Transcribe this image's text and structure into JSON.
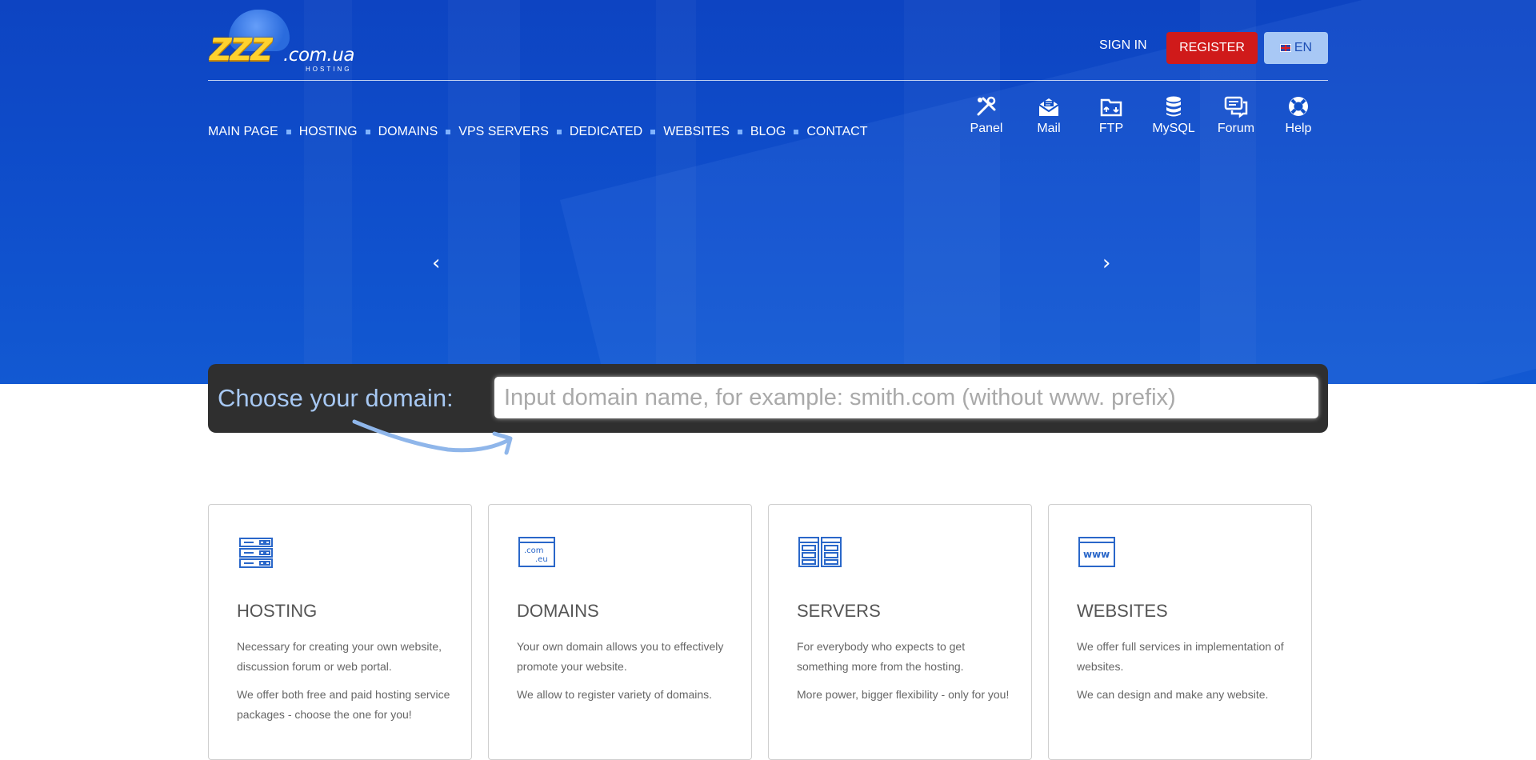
{
  "logo": {
    "zzz": "ZZZ",
    "domain": ".com.ua",
    "tagline": "HOSTING"
  },
  "header": {
    "signin": "SIGN IN",
    "register": "REGISTER",
    "lang": "EN"
  },
  "nav": [
    "MAIN PAGE",
    "HOSTING",
    "DOMAINS",
    "VPS SERVERS",
    "DEDICATED",
    "WEBSITES",
    "BLOG",
    "CONTACT"
  ],
  "tools": [
    {
      "label": "Panel",
      "icon": "tools-icon"
    },
    {
      "label": "Mail",
      "icon": "mail-icon"
    },
    {
      "label": "FTP",
      "icon": "ftp-icon"
    },
    {
      "label": "MySQL",
      "icon": "database-icon"
    },
    {
      "label": "Forum",
      "icon": "forum-icon"
    },
    {
      "label": "Help",
      "icon": "lifebuoy-icon"
    }
  ],
  "slider": {
    "prev": "‹",
    "next": "›"
  },
  "domain_search": {
    "label": "Choose your domain:",
    "placeholder": "Input domain name, for example: smith.com (without www. prefix)"
  },
  "cards": [
    {
      "title": "HOSTING",
      "p1": "Necessary for creating your own website, discussion forum or web portal.",
      "p2": "We offer both free and paid hosting service packages - choose the one for you!"
    },
    {
      "title": "DOMAINS",
      "p1": "Your own domain allows you to effectively promote your website.",
      "p2": "We allow to register variety of domains."
    },
    {
      "title": "SERVERS",
      "p1": "For everybody who expects to get something more from the hosting.",
      "p2": "More power, bigger flexibility - only for you!"
    },
    {
      "title": "WEBSITES",
      "p1": "We offer full services in implementation of websites.",
      "p2": "We can design and make any website."
    }
  ],
  "colors": {
    "hero": "#0f4fcc",
    "register": "#d01a1a",
    "lang": "#a8c8f5",
    "domain_label": "#a7c8f3"
  }
}
